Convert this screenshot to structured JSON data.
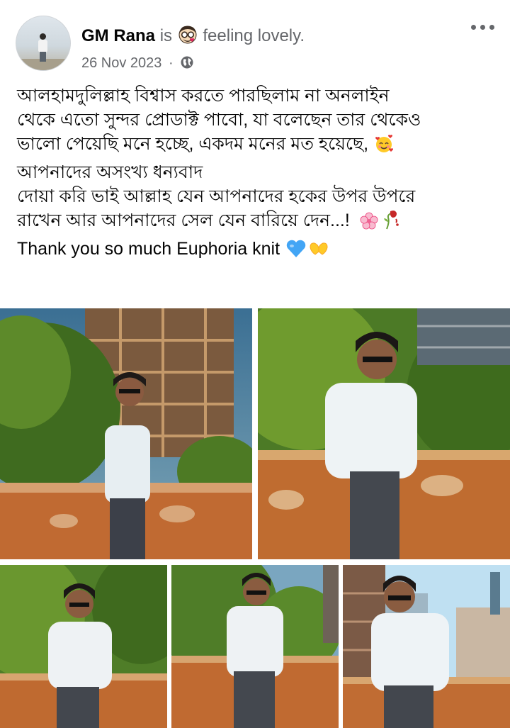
{
  "post": {
    "author": "GM Rana",
    "is_word": "is",
    "feeling_text": "feeling lovely.",
    "feeling_icon": "smiling-face-with-glasses-emoji",
    "date": "26 Nov 2023",
    "separator": "·",
    "privacy_icon": "globe-icon",
    "more_icon": "more-options-icon",
    "text_lines": [
      "আলহামদুলিল্লাহ বিশ্বাস করতে পারছিলাম না অনলাইন",
      "থেকে এতো সুন্দর প্রোডাক্ট পাবো, যা বলেছেন তার থেকেও",
      "ভালো পেয়েছি মনে হচ্ছে, একদম মনের মত হয়েছে,",
      "আপনাদের অসংখ্য ধন্যবাদ",
      "দোয়া করি ভাই আল্লাহ যেন আপনাদের হকের উপর উপরে",
      "রাখেন আর আপনাদের সেল যেন বারিয়ে দেন...!",
      "Thank you so much Euphoria knit"
    ],
    "line_emojis": {
      "line3": "smiling-face-with-hearts-emoji",
      "line6": [
        "cherry-blossom-emoji",
        "wilted-rose-emoji"
      ],
      "line7": [
        "blue-heart-emoji",
        "heart-hands-emoji"
      ]
    }
  },
  "photos": [
    {
      "name": "photo-1",
      "description_icon": "photo"
    },
    {
      "name": "photo-2",
      "description_icon": "photo"
    },
    {
      "name": "photo-3",
      "description_icon": "photo"
    },
    {
      "name": "photo-4",
      "description_icon": "photo"
    },
    {
      "name": "photo-5",
      "description_icon": "photo"
    }
  ],
  "colors": {
    "name": "#050505",
    "secondary": "#65676b",
    "background": "#ffffff"
  }
}
